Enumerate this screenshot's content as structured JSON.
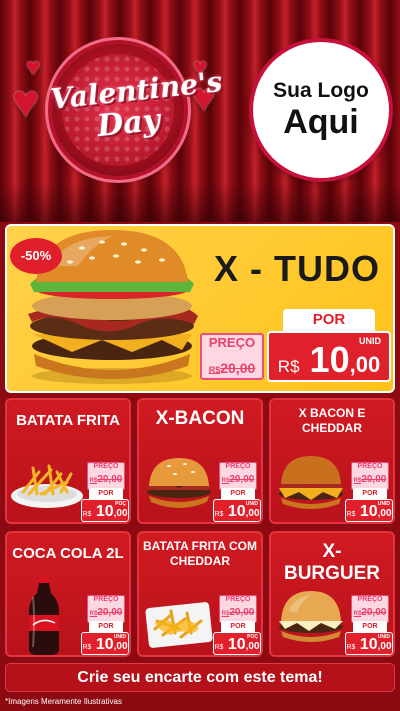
{
  "header": {
    "valentine_line1": "Valentine's",
    "valentine_line2": "Day",
    "logo_line1": "Sua Logo",
    "logo_line2": "Aqui"
  },
  "featured": {
    "discount": "-50%",
    "title": "X - TUDO",
    "preco_label": "PREÇO",
    "old_currency": "R$",
    "old_price": "20,00",
    "por_label": "POR",
    "unit": "UNID",
    "currency": "R$",
    "price_int": "10",
    "price_cents": ",00"
  },
  "products": [
    {
      "title": "BATATA FRITA",
      "preco_label": "PREÇO",
      "old_currency": "R$",
      "old_price": "20,00",
      "por_label": "POR",
      "unit": "POÇ",
      "currency": "R$",
      "price_int": "10",
      "price_cents": ",00"
    },
    {
      "title": "X-BACON",
      "preco_label": "PREÇO",
      "old_currency": "R$",
      "old_price": "20,00",
      "por_label": "POR",
      "unit": "UNID",
      "currency": "R$",
      "price_int": "10",
      "price_cents": ",00"
    },
    {
      "title": "X BACON E CHEDDAR",
      "preco_label": "PREÇO",
      "old_currency": "R$",
      "old_price": "20,00",
      "por_label": "POR",
      "unit": "UNID",
      "currency": "R$",
      "price_int": "10",
      "price_cents": ",00"
    },
    {
      "title": "COCA COLA 2L",
      "preco_label": "PREÇO",
      "old_currency": "R$",
      "old_price": "20,00",
      "por_label": "POR",
      "unit": "UNID",
      "currency": "R$",
      "price_int": "10",
      "price_cents": ",00"
    },
    {
      "title": "BATATA FRITA COM CHEDDAR",
      "preco_label": "PREÇO",
      "old_currency": "R$",
      "old_price": "20,00",
      "por_label": "POR",
      "unit": "POÇ",
      "currency": "R$",
      "price_int": "10",
      "price_cents": ",00"
    },
    {
      "title": "X-BURGUER",
      "preco_label": "PREÇO",
      "old_currency": "R$",
      "old_price": "20,00",
      "por_label": "POR",
      "unit": "UNID",
      "currency": "R$",
      "price_int": "10",
      "price_cents": ",00"
    }
  ],
  "cta": "Crie seu encarte com este tema!",
  "disclaimer": "*Imagens Meramente Ilustrativas",
  "colors": {
    "primary_red": "#e0202b",
    "featured_yellow": "#ffc21a",
    "old_price_pink": "#e8426c"
  }
}
